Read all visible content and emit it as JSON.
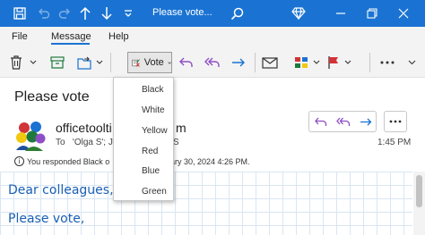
{
  "window": {
    "title": "Please vote..."
  },
  "menu": {
    "file": "File",
    "message": "Message",
    "help": "Help"
  },
  "toolbar": {
    "vote_label": "Vote"
  },
  "vote_menu": {
    "items": [
      "Black",
      "White",
      "Yellow",
      "Red",
      "Blue",
      "Green"
    ]
  },
  "email": {
    "subject": "Please vote",
    "sender": "officetoolti",
    "sender_tail": "m",
    "to_prefix": "To",
    "to_value": "'Olga S'; Ja",
    "to_tail": "S",
    "time": "1:45 PM",
    "info_text": "You responded Black o",
    "info_tail": "ary 30, 2024 4:26 PM.",
    "body_lines": [
      "Dear colleagues,",
      "Please vote,"
    ]
  },
  "colors": {
    "accent": "#1a73d2",
    "body_text": "#1a5fb4"
  }
}
